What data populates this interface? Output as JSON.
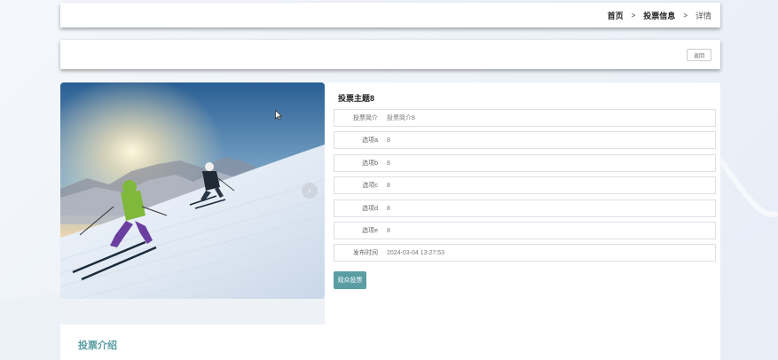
{
  "breadcrumb": {
    "home": "首页",
    "separator": ">",
    "section": "投票信息",
    "current": "详情"
  },
  "actions": {
    "back_label": "返回"
  },
  "detail": {
    "title": "投票主题8",
    "fields": [
      {
        "label": "投票简介",
        "value": "投票简介8"
      },
      {
        "label": "选项a",
        "value": "8"
      },
      {
        "label": "选项b",
        "value": "8"
      },
      {
        "label": "选项c",
        "value": "8"
      },
      {
        "label": "选项d",
        "value": "8"
      },
      {
        "label": "选项e",
        "value": "8"
      },
      {
        "label": "发布时间",
        "value": "2024-03-04 13:27:53"
      }
    ],
    "vote_button": "观众投票"
  },
  "intro": {
    "title": "投票介绍"
  },
  "colors": {
    "accent": "#5a9ea3"
  }
}
